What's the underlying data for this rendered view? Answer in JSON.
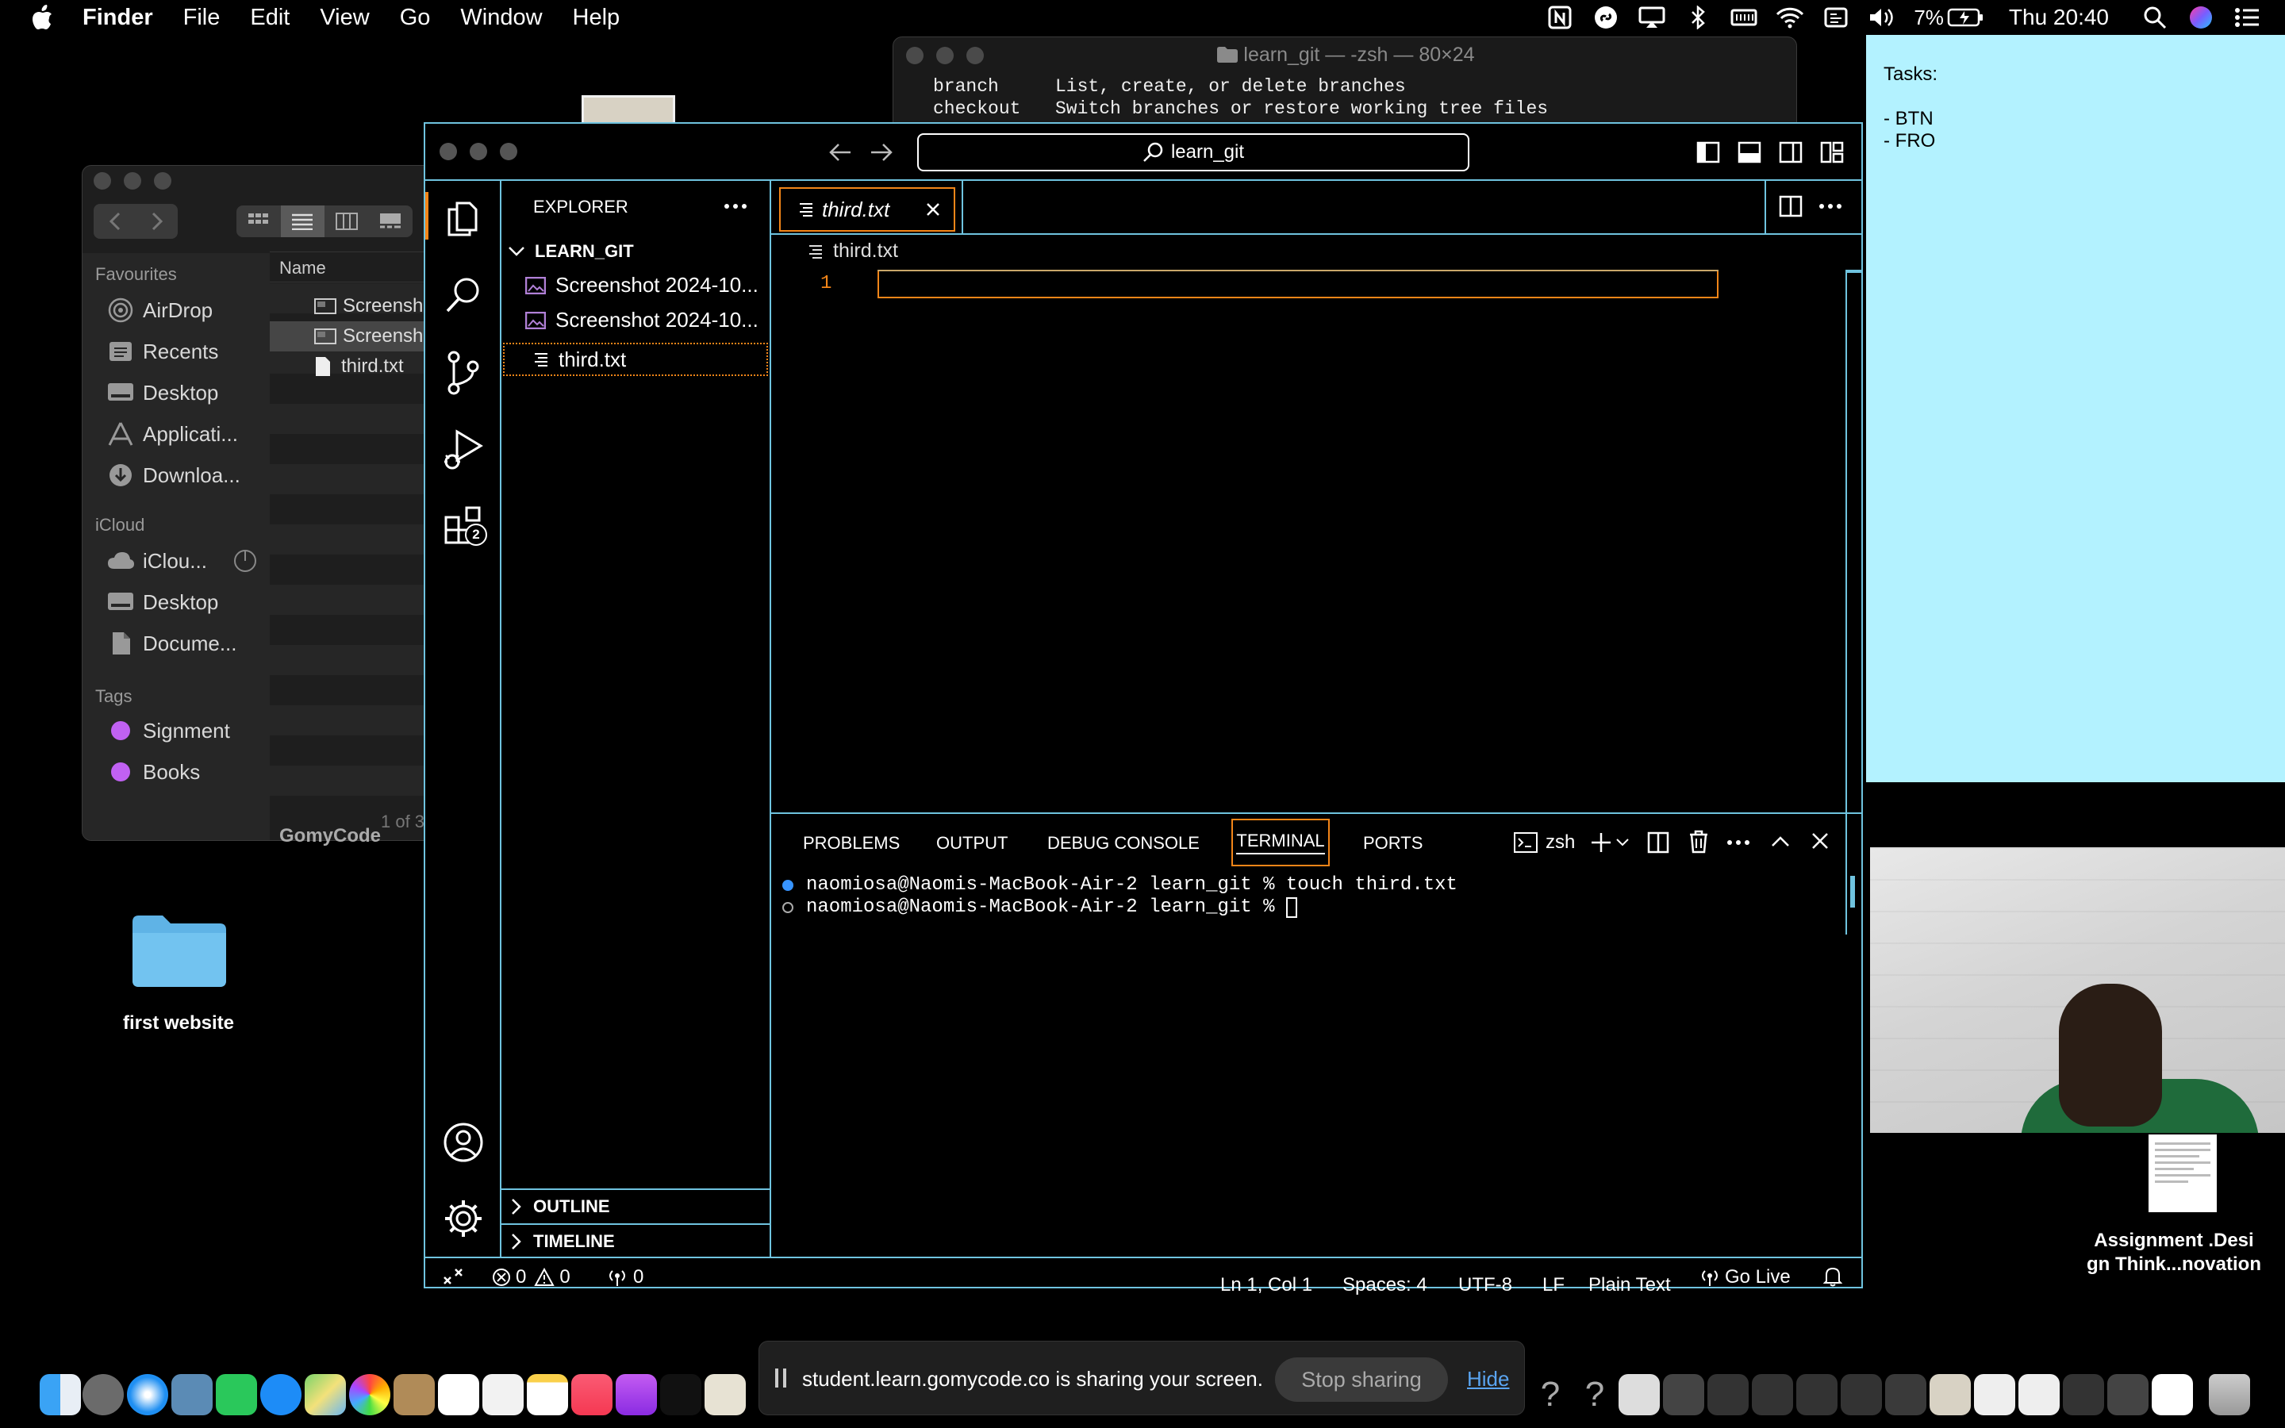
{
  "menubar": {
    "app": "Finder",
    "items": [
      "File",
      "Edit",
      "View",
      "Go",
      "Window",
      "Help"
    ],
    "battery": "7%",
    "clock": "Thu 20:40"
  },
  "sticky": {
    "lines": [
      "Tasks:",
      "",
      "- BTN",
      "- FRO"
    ]
  },
  "desktop": {
    "folder_label": "first website",
    "file_label_1": "Assignment .Desi",
    "file_label_2": "gn Think...novation",
    "partial_label": "GomyCode"
  },
  "finder": {
    "favourites_header": "Favourites",
    "favourites": [
      "AirDrop",
      "Recents",
      "Desktop",
      "Applicati...",
      "Downloa..."
    ],
    "icloud_header": "iCloud",
    "icloud": [
      "iClou...",
      "Desktop",
      "Docume..."
    ],
    "tags_header": "Tags",
    "tags": [
      "Signment",
      "Books"
    ],
    "name_header": "Name",
    "files": [
      "Screensh",
      "Screensh",
      "third.txt"
    ],
    "footer": "1 of 3"
  },
  "termwin": {
    "title": "learn_git — -zsh — 80×24",
    "lines": [
      {
        "cmd": "branch",
        "desc": "List, create, or delete branches"
      },
      {
        "cmd": "checkout",
        "desc": "Switch branches or restore working tree files"
      }
    ]
  },
  "vscode": {
    "search": "learn_git",
    "explorer_title": "EXPLORER",
    "folder": "LEARN_GIT",
    "files": [
      "Screenshot 2024-10...",
      "Screenshot 2024-10...",
      "third.txt"
    ],
    "outline": "OUTLINE",
    "timeline": "TIMELINE",
    "tab": "third.txt",
    "breadcrumb": "third.txt",
    "line_number": "1",
    "extensions_badge": "2",
    "panel_tabs": [
      "PROBLEMS",
      "OUTPUT",
      "DEBUG CONSOLE",
      "TERMINAL",
      "PORTS"
    ],
    "shell": "zsh",
    "terminal_lines": [
      "naomiosa@Naomis-MacBook-Air-2 learn_git % touch third.txt",
      "naomiosa@Naomis-MacBook-Air-2 learn_git % "
    ],
    "status": {
      "errors": "0",
      "warnings": "0",
      "ports": "0",
      "position": "Ln 1, Col 1",
      "spaces": "Spaces: 4",
      "encoding": "UTF-8",
      "eol": "LF",
      "language": "Plain Text",
      "golive": "Go Live"
    }
  },
  "share": {
    "message": "student.learn.gomycode.co is sharing your screen.",
    "stop": "Stop sharing",
    "hide": "Hide"
  }
}
